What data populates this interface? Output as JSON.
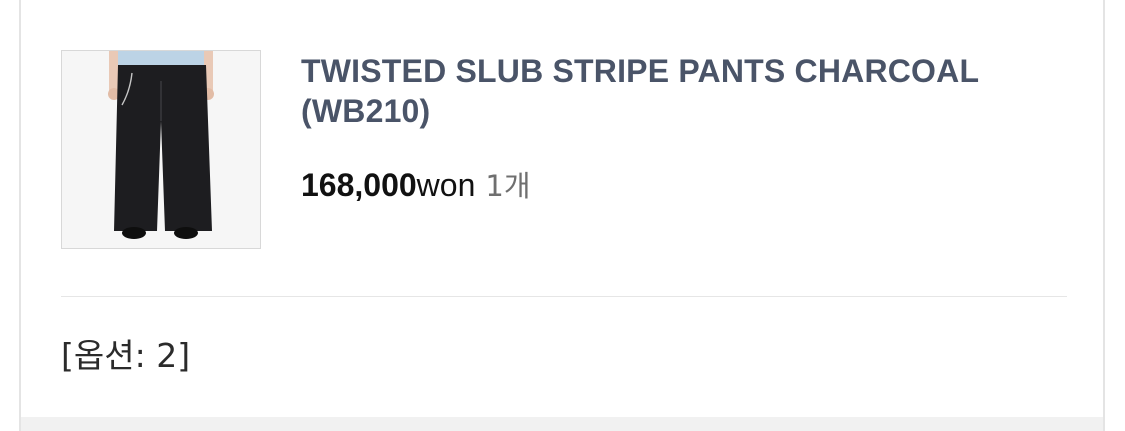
{
  "product": {
    "name": "TWISTED SLUB STRIPE PANTS CHARCOAL (WB210)",
    "price": "168,000",
    "currency": "won",
    "quantity": "1개",
    "option": "[옵션: 2]",
    "image_icon": "product-photo-pants"
  },
  "colors": {
    "title": "#4a5468",
    "price": "#111111",
    "quantity": "#6f6f6f",
    "divider": "#e6e6e6"
  }
}
